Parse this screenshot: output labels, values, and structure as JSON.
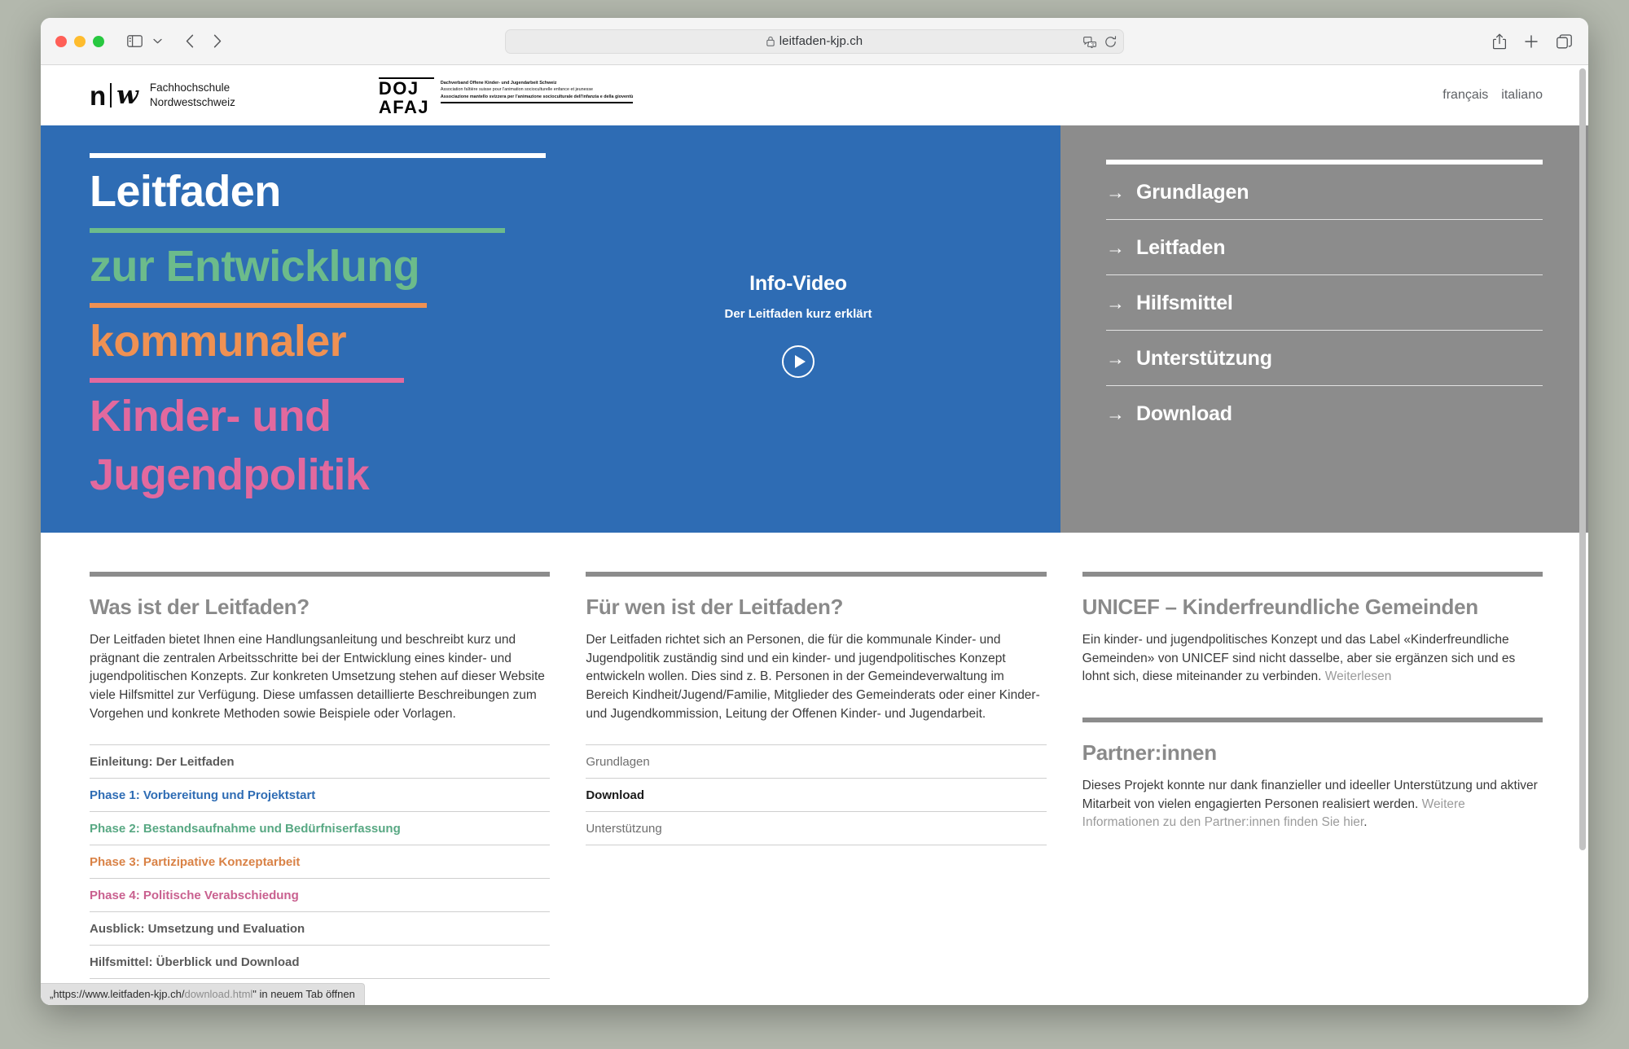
{
  "browser": {
    "url": "leitfaden-kjp.ch",
    "lock_icon": "lock-icon",
    "translate_icon": "translate-icon",
    "reload_icon": "reload-icon",
    "share_icon": "share-icon",
    "new_tab_icon": "plus-icon",
    "tab_overview_icon": "tab-overview-icon",
    "sidebar_icon": "sidebar-icon",
    "back_icon": "chevron-left-icon",
    "forward_icon": "chevron-right-icon"
  },
  "status_bar": {
    "prefix": "„https://www.leitfaden-kjp.ch/",
    "dim": "download.html",
    "suffix": "\" in neuem Tab öffnen"
  },
  "site_header": {
    "fhnw": {
      "letter_n": "n",
      "letter_w": "w",
      "name_line1": "Fachhochschule",
      "name_line2": "Nordwestschweiz"
    },
    "doj": {
      "abbrev_line1": "DOJ",
      "abbrev_line2": "AFAJ",
      "desc_de": "Dachverband Offene Kinder- und Jugendarbeit Schweiz",
      "desc_fr": "Association faîtière suisse pour l'animation socioculturelle enfance et jeunesse",
      "desc_it": "Associazione mantello svizzera per l'animazione socioculturale dell'infanzia e della gioventù"
    },
    "languages": [
      {
        "label": "français"
      },
      {
        "label": "italiano"
      }
    ]
  },
  "hero": {
    "title_lines": [
      {
        "text": "Leitfaden",
        "color": "#ffffff",
        "rule_color": "#ffffff",
        "rule_width": "100%"
      },
      {
        "text": "zur Entwicklung",
        "color": "#6cbb8b",
        "rule_color": "#6cbb8b",
        "rule_width": "91%"
      },
      {
        "text": "kommunaler",
        "color": "#ef9153",
        "rule_color": "#ef9153",
        "rule_width": "74%"
      },
      {
        "text": "Kinder- und",
        "color": "#e2699e",
        "rule_color": "#e2699e",
        "rule_width": "69%"
      },
      {
        "text": "Jugendpolitik",
        "color": "#e2699e",
        "rule_color": "#e2699e",
        "rule_width": "0%"
      }
    ],
    "video": {
      "title": "Info-Video",
      "subtitle": "Der Leitfaden kurz erklärt",
      "play_icon": "play-icon"
    },
    "nav": [
      {
        "arrow": "→",
        "label": "Grundlagen"
      },
      {
        "arrow": "→",
        "label": "Leitfaden"
      },
      {
        "arrow": "→",
        "label": "Hilfsmittel"
      },
      {
        "arrow": "→",
        "label": "Unterstützung"
      },
      {
        "arrow": "→",
        "label": "Download"
      }
    ],
    "background_color": "#2e6cb4",
    "nav_background_color": "#8c8c8c"
  },
  "columns": {
    "col1": {
      "title": "Was ist der Leitfaden?",
      "body": "Der Leitfaden bietet Ihnen eine Handlungsanleitung und beschreibt kurz und prägnant die zentralen Arbeitsschritte bei der Entwicklung eines kinder- und jugendpolitischen Konzepts. Zur konkreten Umsetzung stehen auf dieser Website viele Hilfsmittel zur Verfügung. Diese umfassen detaillierte Beschreibungen zum Vorgehen und konkrete Methoden sowie Beispiele oder Vorlagen.",
      "links": [
        {
          "label": "Einleitung: Der Leitfaden",
          "color": "#5a5a5a",
          "bold": true
        },
        {
          "label": "Phase 1: Vorbereitung und Projektstart",
          "color": "#2e6cb4",
          "bold": true
        },
        {
          "label": "Phase 2: Bestandsaufnahme und Bedürfniserfassung",
          "color": "#58a883",
          "bold": true
        },
        {
          "label": "Phase 3: Partizipative Konzeptarbeit",
          "color": "#d98246",
          "bold": true
        },
        {
          "label": "Phase 4: Politische Verabschiedung",
          "color": "#c9608f",
          "bold": true
        },
        {
          "label": "Ausblick: Umsetzung und Evaluation",
          "color": "#5a5a5a",
          "bold": true
        },
        {
          "label": "Hilfsmittel: Überblick und Download",
          "color": "#5a5a5a",
          "bold": true
        }
      ]
    },
    "col2": {
      "title": "Für wen ist der Leitfaden?",
      "body": "Der Leitfaden richtet sich an Personen, die für die kommunale Kinder- und Jugendpolitik zuständig sind und ein kinder- und jugendpolitisches Konzept entwickeln wollen. Dies sind z. B. Personen in der Gemeindeverwaltung im Bereich Kindheit/Jugend/Familie, Mitglieder des Gemeinderats oder einer Kinder- und Jugendkommission, Leitung der Offenen Kinder- und Jugendarbeit.",
      "links": [
        {
          "label": "Grundlagen",
          "color": "#6f6f6f",
          "bold": false
        },
        {
          "label": "Download",
          "color": "#1b1b1b",
          "bold": true
        },
        {
          "label": "Unterstützung",
          "color": "#6f6f6f",
          "bold": false
        }
      ]
    },
    "col3": {
      "unicef": {
        "title": "UNICEF – Kinderfreundliche Gemeinden",
        "body": "Ein kinder- und jugendpolitisches Konzept und das Label «Kinderfreundliche Gemeinden» von UNICEF sind nicht dasselbe, aber sie ergänzen sich und es lohnt sich, diese miteinander zu verbinden. ",
        "link_label": "Weiterlesen"
      },
      "partner": {
        "title": "Partner:innen",
        "body": "Dieses Projekt konnte nur dank finanzieller und ideeller Unterstützung und aktiver Mitarbeit von vielen engagierten Personen realisiert werden. ",
        "link_label": "Weitere Informationen zu den Partner:innen finden Sie hier",
        "body_end": "."
      }
    }
  }
}
